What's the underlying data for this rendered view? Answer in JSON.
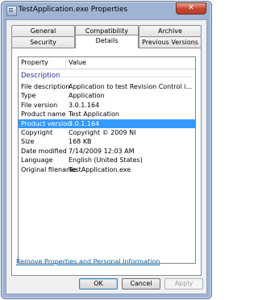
{
  "window": {
    "title": "TestApplication.exe Properties",
    "close_label": "✕"
  },
  "tabs_top": [
    "General",
    "Compatibility",
    "Archive"
  ],
  "tabs_bottom": [
    "Security",
    "Details",
    "Previous Versions"
  ],
  "active_tab": "Details",
  "list": {
    "header": {
      "property": "Property",
      "value": "Value"
    },
    "group": "Description",
    "rows": [
      {
        "property": "File description",
        "value": "Application to test Revision Control in La..."
      },
      {
        "property": "Type",
        "value": "Application"
      },
      {
        "property": "File version",
        "value": "3.0.1.164"
      },
      {
        "property": "Product name",
        "value": "Test Application"
      },
      {
        "property": "Product version",
        "value": "3.0.1.164",
        "selected": true
      },
      {
        "property": "Copyright",
        "value": "Copyright © 2009 NI"
      },
      {
        "property": "Size",
        "value": "168 KB"
      },
      {
        "property": "Date modified",
        "value": "7/14/2009 12:03 AM"
      },
      {
        "property": "Language",
        "value": "English (United States)"
      },
      {
        "property": "Original filename",
        "value": "TestApplication.exe"
      }
    ]
  },
  "link": "Remove Properties and Personal Information",
  "buttons": {
    "ok": "OK",
    "cancel": "Cancel",
    "apply": "Apply"
  },
  "colors": {
    "selection": "#3399ff",
    "group_label": "#1e3287",
    "link": "#0b62b0"
  }
}
